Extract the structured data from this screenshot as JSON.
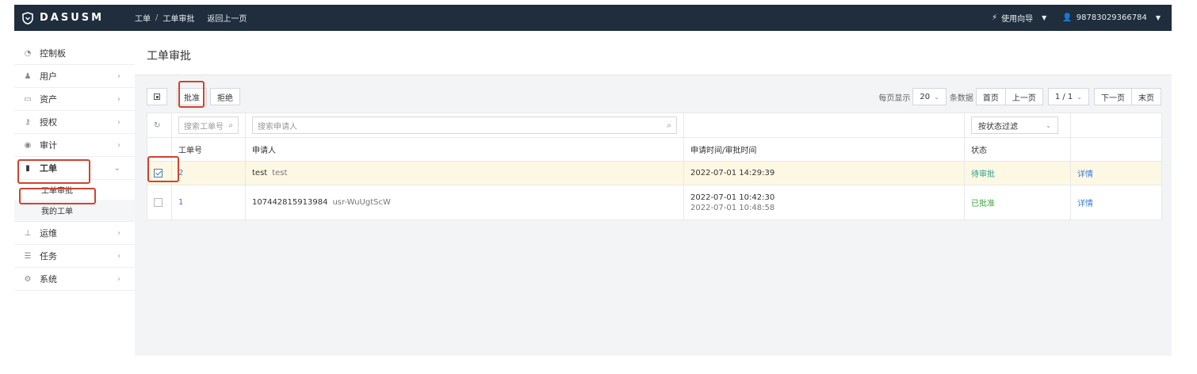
{
  "app": {
    "brand": "DASUSM"
  },
  "header": {
    "breadcrumb": [
      "工单",
      "工单审批"
    ],
    "back_link": "返回上一页",
    "guide_label": "使用向导",
    "user_label": "98783029366784"
  },
  "sidebar": {
    "items": [
      {
        "label": "控制板",
        "icon": "dashboard-icon"
      },
      {
        "label": "用户",
        "icon": "user-icon"
      },
      {
        "label": "资产",
        "icon": "monitor-icon"
      },
      {
        "label": "授权",
        "icon": "key-icon"
      },
      {
        "label": "审计",
        "icon": "eye-icon"
      },
      {
        "label": "工单",
        "icon": "file-icon"
      },
      {
        "label": "运维",
        "icon": "sitemap-icon"
      },
      {
        "label": "任务",
        "icon": "tasks-icon"
      },
      {
        "label": "系统",
        "icon": "gear-icon"
      }
    ],
    "subitems": [
      "工单审批",
      "我的工单"
    ]
  },
  "page": {
    "title": "工单审批"
  },
  "toolbar": {
    "approve_label": "批准",
    "reject_label": "拒绝"
  },
  "pager": {
    "per_page_label": "每页显示",
    "per_page_value": "20",
    "rows_label": "条数据",
    "first": "首页",
    "prev": "上一页",
    "page_info": "1 / 1",
    "next": "下一页",
    "last": "末页"
  },
  "filters": {
    "ticket_placeholder": "搜索工单号",
    "applicant_placeholder": "搜索申请人",
    "status_placeholder": "按状态过滤"
  },
  "table": {
    "headers": [
      "工单号",
      "申请人",
      "申请时间/审批时间",
      "状态",
      ""
    ],
    "rows": [
      {
        "id": "2",
        "applicant": "test",
        "applicant_sub": "test",
        "time1": "2022-07-01 14:29:39",
        "time2": "",
        "status": "待审批",
        "action": "详情",
        "checked": true
      },
      {
        "id": "1",
        "applicant": "107442815913984",
        "applicant_sub": "usr-WuUgtScW",
        "time1": "2022-07-01 10:42:30",
        "time2": "2022-07-01 10:48:58",
        "status": "已批准",
        "action": "详情",
        "checked": false
      }
    ]
  },
  "colors": {
    "topbar": "#1f2d3d",
    "highlight": "#d0442f",
    "row_highlight": "#fcf8e3",
    "link": "#3a7bd5"
  }
}
